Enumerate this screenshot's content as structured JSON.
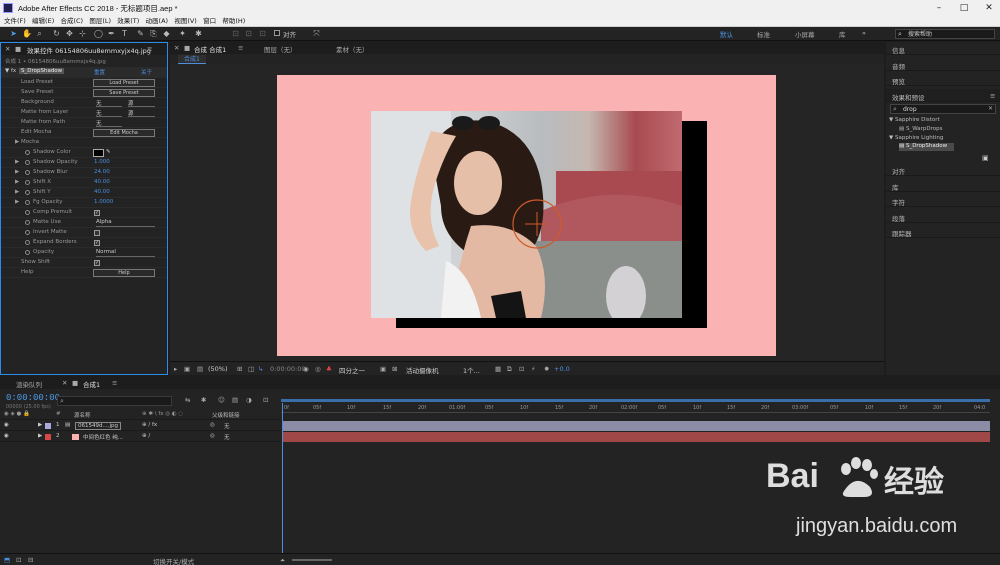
{
  "window": {
    "title": "Adobe After Effects CC 2018 - 无标题项目.aep *"
  },
  "menu": [
    "文件(F)",
    "编辑(E)",
    "合成(C)",
    "图层(L)",
    "效果(T)",
    "动画(A)",
    "视图(V)",
    "窗口",
    "帮助(H)"
  ],
  "toolbar": {
    "align_label": "对齐",
    "workspaces": [
      "默认",
      "标准",
      "小屏幕",
      "库"
    ],
    "search_placeholder": "搜索帮助"
  },
  "effect_controls": {
    "tab_label": "效果控件 06154806uu8emmxyjx4q.jpg",
    "subtitle": "合成 1 • 06154806uu8emmxjx4q.jpg",
    "effect_name": "S_DropShadow",
    "reset": "重置",
    "about": "关于",
    "rows": [
      {
        "label": "Load Preset",
        "button": "Load Preset"
      },
      {
        "label": "Save Preset",
        "button": "Save Preset"
      },
      {
        "label": "Background",
        "sel1": "无",
        "sel2": "源"
      },
      {
        "label": "Matte from Layer",
        "sel1": "无",
        "sel2": "源"
      },
      {
        "label": "Matte from Path",
        "sel1": "无"
      },
      {
        "label": "Edit Mocha",
        "button": "Edit Mocha"
      },
      {
        "label": "Mocha"
      },
      {
        "label": "Shadow Color"
      },
      {
        "label": "Shadow Opacity",
        "value": "1.000"
      },
      {
        "label": "Shadow Blur",
        "value": "24.00"
      },
      {
        "label": "Shift X",
        "value": "40.00"
      },
      {
        "label": "Shift Y",
        "value": "40.00"
      },
      {
        "label": "Fg Opacity",
        "value": "1.0000"
      },
      {
        "label": "Comp Premult"
      },
      {
        "label": "Matte Use",
        "sel1": "Alpha"
      },
      {
        "label": "Invert Matte"
      },
      {
        "label": "Expand Borders"
      },
      {
        "label": "Opacity",
        "sel1": "Normal"
      },
      {
        "label": "Show Shift"
      },
      {
        "label": "Help",
        "button": "Help"
      }
    ]
  },
  "composition": {
    "tab_label": "合成 合成1",
    "layer_tab": "图层（无）",
    "footage_tab": "素材（无）",
    "breadcrumb": "合成1",
    "zoom": "(50%)",
    "timecode": "0:00:00:00",
    "resolution": "四分之一",
    "camera": "活动摄像机",
    "views": "1个...",
    "exposure": "+0.0"
  },
  "right_panels": [
    "信息",
    "音频",
    "预览",
    "效果和预设",
    "对齐",
    "库",
    "字符",
    "段落",
    "跟踪器"
  ],
  "effects_presets": {
    "search_value": "drop",
    "groups": [
      {
        "name": "Sapphire Distort",
        "items": [
          "S_WarpDrops"
        ]
      },
      {
        "name": "Sapphire Lighting",
        "items": [
          "S_DropShadow"
        ]
      }
    ]
  },
  "timeline": {
    "render_queue_tab": "渲染队列",
    "comp_tab": "合成1",
    "timecode": "0:00:00:00",
    "fps": "00000 (25.00 fps)",
    "columns": {
      "source_name": "源名称",
      "parent": "父级和链接"
    },
    "layers": [
      {
        "num": "1",
        "name": "061549d....jpg",
        "parent": "无"
      },
      {
        "num": "2",
        "name": "中间色红色 纯...",
        "parent": "无"
      }
    ],
    "ruler": [
      "0f",
      "05f",
      "10f",
      "15f",
      "20f",
      "01:00f",
      "05f",
      "10f",
      "15f",
      "20f",
      "02:00f",
      "05f",
      "10f",
      "15f",
      "20f",
      "03:00f",
      "05f",
      "10f",
      "15f",
      "20f",
      "04:0"
    ]
  },
  "status": {
    "toggle_label": "切换开关/模式"
  },
  "watermark": {
    "brand": "Bai",
    "brand2": "经验",
    "url": "jingyan.baidu.com"
  },
  "colors": {
    "accent": "#2d8ceb",
    "canvas_bg": "#fbb2b2",
    "layer1_label": "#a9a9e0",
    "layer2_label": "#d44848",
    "track1": "#8c8ca6",
    "track2": "#a04848"
  }
}
